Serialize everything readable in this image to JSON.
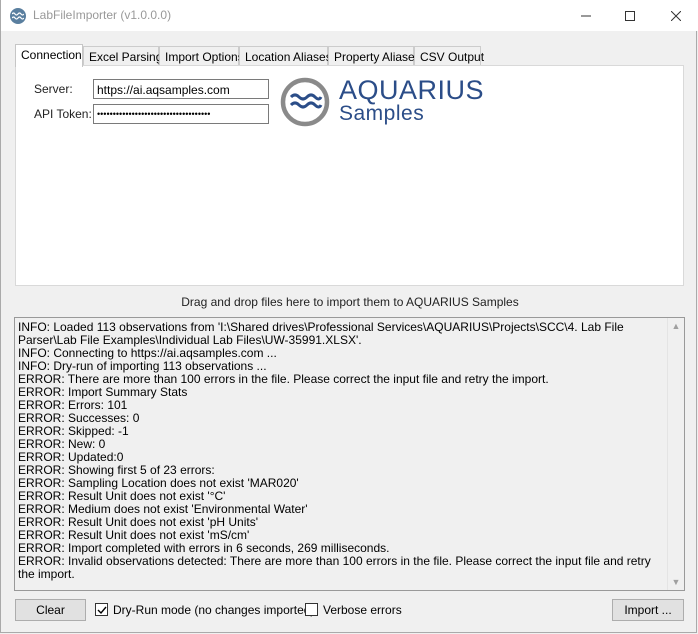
{
  "window": {
    "title": "LabFileImporter (v1.0.0.0)",
    "minimize": "—",
    "maximize": "☐",
    "close": "✕"
  },
  "tabs": [
    {
      "label": "Connection",
      "active": true
    },
    {
      "label": "Excel Parsing",
      "active": false
    },
    {
      "label": "Import Options",
      "active": false
    },
    {
      "label": "Location Aliases",
      "active": false
    },
    {
      "label": "Property Aliases",
      "active": false
    },
    {
      "label": "CSV Output",
      "active": false
    }
  ],
  "connection": {
    "server_label": "Server:",
    "server_value": "https://ai.aqsamples.com",
    "token_label": "API Token:",
    "token_value": "••••••••••••••••••••••••••••••••••••"
  },
  "logo": {
    "word1": "AQUARIUS",
    "word2": "Samples",
    "color": "#2b4d88",
    "icon": "waves-circle-icon"
  },
  "dropzone_text": "Drag and drop files here to import  them to AQUARIUS Samples",
  "log_lines": [
    "INFO: Loaded 113 observations from 'I:\\Shared drives\\Professional Services\\AQUARIUS\\Projects\\SCC\\4. Lab File Parser\\Lab File Examples\\Individual Lab Files\\UW-35991.XLSX'.",
    "INFO: Connecting to https://ai.aqsamples.com ...",
    "INFO: Dry-run of importing 113 observations ...",
    "ERROR: There are more than 100 errors in the file. Please correct the input file and retry the import.",
    "ERROR: Import Summary Stats",
    "ERROR: Errors: 101",
    "ERROR: Successes: 0",
    "ERROR: Skipped: -1",
    "ERROR: New: 0",
    "ERROR: Updated:0",
    "ERROR: Showing first 5 of 23 errors:",
    "ERROR: Sampling Location does not exist 'MAR020'",
    "ERROR: Result Unit does not exist '°C'",
    "ERROR: Medium does not exist 'Environmental Water'",
    "ERROR: Result Unit does not exist 'pH Units'",
    "ERROR: Result Unit does not exist 'mS/cm'",
    "ERROR: Import completed with errors in 6 seconds, 269 milliseconds.",
    "ERROR: Invalid observations detected: There are more than 100 errors in the file. Please correct the input file and retry the import."
  ],
  "bottom": {
    "clear_label": "Clear",
    "dryrun_label": "Dry-Run mode (no changes imported)",
    "dryrun_checked": true,
    "verbose_label": "Verbose errors",
    "verbose_checked": false,
    "import_label": "Import ..."
  }
}
